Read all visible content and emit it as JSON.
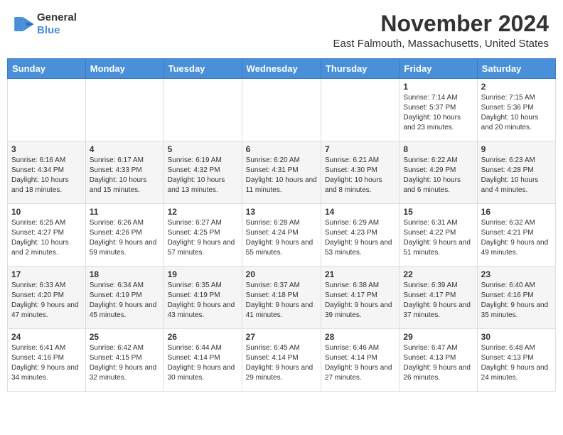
{
  "header": {
    "logo_general": "General",
    "logo_blue": "Blue",
    "title": "November 2024",
    "location": "East Falmouth, Massachusetts, United States"
  },
  "days_of_week": [
    "Sunday",
    "Monday",
    "Tuesday",
    "Wednesday",
    "Thursday",
    "Friday",
    "Saturday"
  ],
  "weeks": [
    [
      {
        "day": "",
        "info": ""
      },
      {
        "day": "",
        "info": ""
      },
      {
        "day": "",
        "info": ""
      },
      {
        "day": "",
        "info": ""
      },
      {
        "day": "",
        "info": ""
      },
      {
        "day": "1",
        "info": "Sunrise: 7:14 AM\nSunset: 5:37 PM\nDaylight: 10 hours and 23 minutes."
      },
      {
        "day": "2",
        "info": "Sunrise: 7:15 AM\nSunset: 5:36 PM\nDaylight: 10 hours and 20 minutes."
      }
    ],
    [
      {
        "day": "3",
        "info": "Sunrise: 6:16 AM\nSunset: 4:34 PM\nDaylight: 10 hours and 18 minutes."
      },
      {
        "day": "4",
        "info": "Sunrise: 6:17 AM\nSunset: 4:33 PM\nDaylight: 10 hours and 15 minutes."
      },
      {
        "day": "5",
        "info": "Sunrise: 6:19 AM\nSunset: 4:32 PM\nDaylight: 10 hours and 13 minutes."
      },
      {
        "day": "6",
        "info": "Sunrise: 6:20 AM\nSunset: 4:31 PM\nDaylight: 10 hours and 11 minutes."
      },
      {
        "day": "7",
        "info": "Sunrise: 6:21 AM\nSunset: 4:30 PM\nDaylight: 10 hours and 8 minutes."
      },
      {
        "day": "8",
        "info": "Sunrise: 6:22 AM\nSunset: 4:29 PM\nDaylight: 10 hours and 6 minutes."
      },
      {
        "day": "9",
        "info": "Sunrise: 6:23 AM\nSunset: 4:28 PM\nDaylight: 10 hours and 4 minutes."
      }
    ],
    [
      {
        "day": "10",
        "info": "Sunrise: 6:25 AM\nSunset: 4:27 PM\nDaylight: 10 hours and 2 minutes."
      },
      {
        "day": "11",
        "info": "Sunrise: 6:26 AM\nSunset: 4:26 PM\nDaylight: 9 hours and 59 minutes."
      },
      {
        "day": "12",
        "info": "Sunrise: 6:27 AM\nSunset: 4:25 PM\nDaylight: 9 hours and 57 minutes."
      },
      {
        "day": "13",
        "info": "Sunrise: 6:28 AM\nSunset: 4:24 PM\nDaylight: 9 hours and 55 minutes."
      },
      {
        "day": "14",
        "info": "Sunrise: 6:29 AM\nSunset: 4:23 PM\nDaylight: 9 hours and 53 minutes."
      },
      {
        "day": "15",
        "info": "Sunrise: 6:31 AM\nSunset: 4:22 PM\nDaylight: 9 hours and 51 minutes."
      },
      {
        "day": "16",
        "info": "Sunrise: 6:32 AM\nSunset: 4:21 PM\nDaylight: 9 hours and 49 minutes."
      }
    ],
    [
      {
        "day": "17",
        "info": "Sunrise: 6:33 AM\nSunset: 4:20 PM\nDaylight: 9 hours and 47 minutes."
      },
      {
        "day": "18",
        "info": "Sunrise: 6:34 AM\nSunset: 4:19 PM\nDaylight: 9 hours and 45 minutes."
      },
      {
        "day": "19",
        "info": "Sunrise: 6:35 AM\nSunset: 4:19 PM\nDaylight: 9 hours and 43 minutes."
      },
      {
        "day": "20",
        "info": "Sunrise: 6:37 AM\nSunset: 4:18 PM\nDaylight: 9 hours and 41 minutes."
      },
      {
        "day": "21",
        "info": "Sunrise: 6:38 AM\nSunset: 4:17 PM\nDaylight: 9 hours and 39 minutes."
      },
      {
        "day": "22",
        "info": "Sunrise: 6:39 AM\nSunset: 4:17 PM\nDaylight: 9 hours and 37 minutes."
      },
      {
        "day": "23",
        "info": "Sunrise: 6:40 AM\nSunset: 4:16 PM\nDaylight: 9 hours and 35 minutes."
      }
    ],
    [
      {
        "day": "24",
        "info": "Sunrise: 6:41 AM\nSunset: 4:16 PM\nDaylight: 9 hours and 34 minutes."
      },
      {
        "day": "25",
        "info": "Sunrise: 6:42 AM\nSunset: 4:15 PM\nDaylight: 9 hours and 32 minutes."
      },
      {
        "day": "26",
        "info": "Sunrise: 6:44 AM\nSunset: 4:14 PM\nDaylight: 9 hours and 30 minutes."
      },
      {
        "day": "27",
        "info": "Sunrise: 6:45 AM\nSunset: 4:14 PM\nDaylight: 9 hours and 29 minutes."
      },
      {
        "day": "28",
        "info": "Sunrise: 6:46 AM\nSunset: 4:14 PM\nDaylight: 9 hours and 27 minutes."
      },
      {
        "day": "29",
        "info": "Sunrise: 6:47 AM\nSunset: 4:13 PM\nDaylight: 9 hours and 26 minutes."
      },
      {
        "day": "30",
        "info": "Sunrise: 6:48 AM\nSunset: 4:13 PM\nDaylight: 9 hours and 24 minutes."
      }
    ]
  ]
}
